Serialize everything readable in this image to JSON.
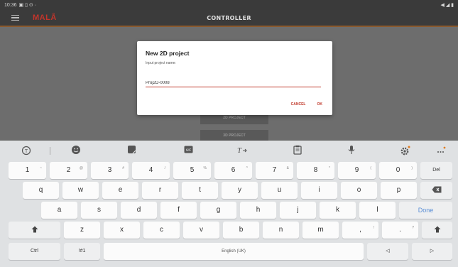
{
  "status_bar": {
    "time": "10:36",
    "icons_left": "▣ ▯ ⊙ ·",
    "icons_right": "◀ ◢ ▮"
  },
  "app_bar": {
    "logo": "MALÅ",
    "title": "CONTROLLER"
  },
  "background": {
    "buttons": [
      "2D PROJECT",
      "3D PROJECT"
    ]
  },
  "dialog": {
    "title": "New 2D project",
    "subtitle": "Input project name:",
    "input_value": "Proj2D-0008",
    "cancel_label": "CANCEL",
    "ok_label": "OK"
  },
  "keyboard": {
    "toolbar": {
      "settings_dot_color": "#e07b20",
      "more_dot_color": "#e07b20"
    },
    "number_row": [
      {
        "label": "1",
        "hint": "~"
      },
      {
        "label": "2",
        "hint": "@"
      },
      {
        "label": "3",
        "hint": "#"
      },
      {
        "label": "4",
        "hint": "/"
      },
      {
        "label": "5",
        "hint": "%"
      },
      {
        "label": "6",
        "hint": "^"
      },
      {
        "label": "7",
        "hint": "&"
      },
      {
        "label": "8",
        "hint": "*"
      },
      {
        "label": "9",
        "hint": "("
      },
      {
        "label": "0",
        "hint": ")"
      }
    ],
    "del_label": "Del",
    "row_q": [
      "q",
      "w",
      "e",
      "r",
      "t",
      "y",
      "u",
      "i",
      "o",
      "p"
    ],
    "row_a": [
      "a",
      "s",
      "d",
      "f",
      "g",
      "h",
      "j",
      "k",
      "l"
    ],
    "done_label": "Done",
    "row_z": [
      "z",
      "x",
      "c",
      "v",
      "b",
      "n",
      "m"
    ],
    "comma": {
      "label": ",",
      "hint": "!"
    },
    "period": {
      "label": ".",
      "hint": "?"
    },
    "ctrl_label": "Ctrl",
    "symbols_label": "!#1",
    "space_label": "English (UK)",
    "shift_glyph": "🡅",
    "left_glyph": "◁",
    "right_glyph": "▷",
    "accent_color": "#5b8fd6"
  }
}
